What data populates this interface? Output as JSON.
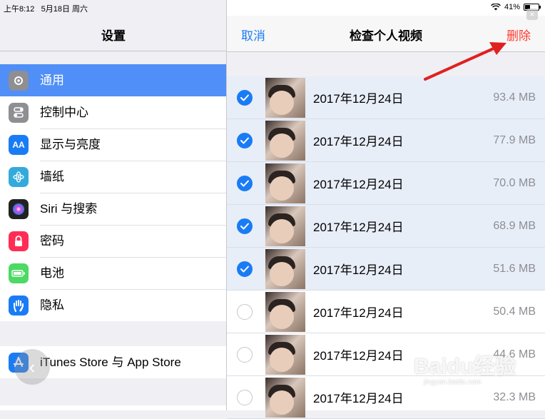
{
  "status_bar": {
    "time": "上午8:12",
    "date": "5月18日 周六",
    "battery_pct": "41%",
    "battery_level": 0.41
  },
  "settings": {
    "title": "设置",
    "items": [
      {
        "label": "通用",
        "icon": "gear-icon",
        "color": "#8e8e93",
        "selected": true
      },
      {
        "label": "控制中心",
        "icon": "control-center-icon",
        "color": "#8e8e93"
      },
      {
        "label": "显示与亮度",
        "icon": "display-brightness-icon",
        "color": "#1a7cf5"
      },
      {
        "label": "墙纸",
        "icon": "wallpaper-flower-icon",
        "color": "#34aadc"
      },
      {
        "label": "Siri 与搜索",
        "icon": "siri-icon",
        "color": "#222"
      },
      {
        "label": "密码",
        "icon": "lock-icon",
        "color": "#ff2d55"
      },
      {
        "label": "电池",
        "icon": "battery-icon",
        "color": "#4cd964"
      },
      {
        "label": "隐私",
        "icon": "hand-icon",
        "color": "#1a7cf5"
      }
    ],
    "store_item": {
      "label": "iTunes Store 与 App Store",
      "icon": "app-store-icon",
      "color": "#1a7cf5"
    }
  },
  "review": {
    "cancel_label": "取消",
    "title": "检查个人视频",
    "delete_label": "删除",
    "videos": [
      {
        "date": "2017年12月24日",
        "size": "93.4 MB",
        "checked": true
      },
      {
        "date": "2017年12月24日",
        "size": "77.9 MB",
        "checked": true
      },
      {
        "date": "2017年12月24日",
        "size": "70.0 MB",
        "checked": true
      },
      {
        "date": "2017年12月24日",
        "size": "68.9 MB",
        "checked": true
      },
      {
        "date": "2017年12月24日",
        "size": "51.6 MB",
        "checked": true
      },
      {
        "date": "2017年12月24日",
        "size": "50.4 MB",
        "checked": false
      },
      {
        "date": "2017年12月24日",
        "size": "44.6 MB",
        "checked": false
      },
      {
        "date": "2017年12月24日",
        "size": "32.3 MB",
        "checked": false
      }
    ]
  },
  "watermark": {
    "brand": "Baidu经验",
    "url": "jingyan.baidu.com"
  },
  "colors": {
    "accent": "#1a7cf5",
    "destructive": "#ff3b30",
    "selected_row": "#4f8ff7",
    "annotation": "#e02020"
  }
}
